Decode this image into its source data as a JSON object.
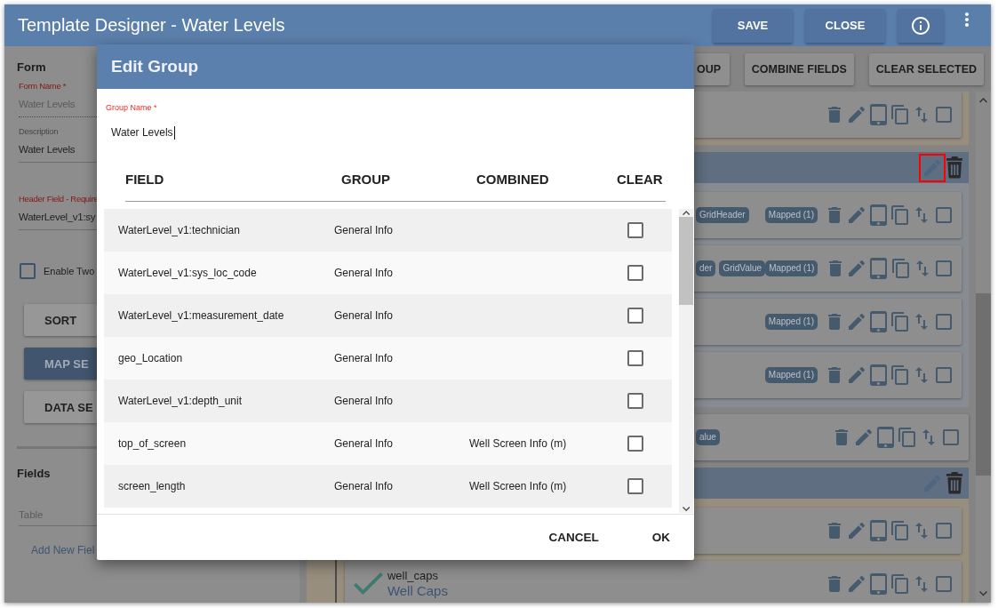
{
  "window": {
    "title": "Template Designer - Water Levels",
    "actions": [
      {
        "label": "SAVE"
      },
      {
        "label": "CLOSE"
      }
    ]
  },
  "form_panel": {
    "heading": "Form",
    "inputs": [
      {
        "label": "Form Name *",
        "value": "Water Levels",
        "required": true,
        "disabled": true
      },
      {
        "label": "Description",
        "value": "Water Levels",
        "required": false,
        "disabled": false
      },
      {
        "label": "Header Field - Require",
        "value": "WaterLevel_v1:sy",
        "required": true,
        "disabled": false
      }
    ],
    "option": {
      "label": "Enable Two",
      "checked": false
    },
    "buttons": [
      {
        "label": "SORT",
        "primary": false
      },
      {
        "label": "MAP SE",
        "primary": true
      },
      {
        "label": "DATA SE",
        "primary": false
      }
    ],
    "fields_heading": "Fields",
    "fields_input": {
      "placeholder": "Table"
    },
    "add_link": "Add New Fiel"
  },
  "toolbar": {
    "buttons": [
      {
        "label": "OUP"
      },
      {
        "label": "COMBINE FIELDS"
      },
      {
        "label": "CLEAR SELECTED"
      }
    ]
  },
  "designer": {
    "items": [
      {
        "kind": "group",
        "color": "#978e7e",
        "header": false,
        "cards": [
          {
            "selected": false
          }
        ]
      },
      {
        "kind": "group",
        "color": "#878c92",
        "header": true,
        "edit_highlighted": true,
        "cards": [
          {
            "tags": [
              "GridHeader"
            ],
            "mapped": "Mapped (1)",
            "selected": false
          },
          {
            "tags": [
              "der",
              "GridValue"
            ],
            "mapped": "Mapped (1)",
            "selected": false
          },
          {
            "mapped": "Mapped (1)",
            "selected": false
          },
          {
            "mapped": "Mapped (1)",
            "selected": false
          }
        ]
      },
      {
        "kind": "card",
        "tags": [
          "alue"
        ],
        "selected": false
      },
      {
        "kind": "group",
        "color": "#978e7e",
        "header": true,
        "edit_highlighted": false,
        "cards": [
          {
            "selected": false
          },
          {
            "selected": false,
            "field": {
              "name": "well_caps",
              "label": "Well Caps",
              "valid": true
            }
          }
        ]
      }
    ]
  },
  "dialog": {
    "title": "Edit Group",
    "group_name": {
      "label": "Group Name *",
      "value": "Water Levels",
      "focused": true
    },
    "columns": [
      "FIELD",
      "GROUP",
      "COMBINED",
      "CLEAR"
    ],
    "rows": [
      {
        "field": "WaterLevel_v1:technician",
        "group": "General Info",
        "clear": false
      },
      {
        "field": "WaterLevel_v1:sys_loc_code",
        "group": "General Info",
        "clear": false
      },
      {
        "field": "WaterLevel_v1:measurement_date",
        "group": "General Info",
        "clear": false
      },
      {
        "field": "geo_Location",
        "group": "General Info",
        "clear": false
      },
      {
        "field": "WaterLevel_v1:depth_unit",
        "group": "General Info",
        "clear": false
      },
      {
        "field": "top_of_screen",
        "group": "General Info",
        "combined": "Well Screen Info (m)",
        "clear": false
      },
      {
        "field": "screen_length",
        "group": "General Info",
        "combined": "Well Screen Info (m)",
        "clear": false
      }
    ],
    "actions": [
      {
        "label": "CANCEL"
      },
      {
        "label": "OK"
      }
    ]
  }
}
